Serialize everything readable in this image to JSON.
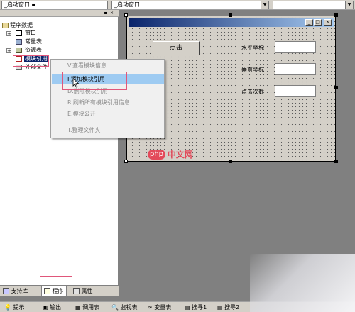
{
  "toolbar": {
    "combo1": "_启动窗口",
    "combo1_marker": "▪",
    "combo2": "_启动窗口",
    "combo3": "",
    "arrow": "▼"
  },
  "panel": {
    "pin": "▪",
    "close": "×"
  },
  "tree": {
    "root": "程序数据",
    "items": [
      {
        "label": "窗口",
        "expander": "+"
      },
      {
        "label": "常量表...",
        "expander": ""
      },
      {
        "label": "资源表",
        "expander": "+"
      },
      {
        "label": "模块引用",
        "expander": "",
        "selected": true
      },
      {
        "label": "外部文件",
        "expander": ""
      }
    ]
  },
  "context_menu": {
    "items": [
      {
        "label": "V.查看模块信息",
        "enabled": false,
        "active": false
      },
      {
        "label": "I.添加模块引用",
        "enabled": true,
        "active": true
      },
      {
        "label": "D.删除模块引用",
        "enabled": false,
        "active": false
      },
      {
        "label": "R.刷新所有模块引用信息",
        "enabled": false,
        "active": false
      },
      {
        "label": "E.模块公开",
        "enabled": false,
        "active": false
      },
      {
        "label": "T.整理文件夹",
        "enabled": false,
        "active": false
      }
    ]
  },
  "left_tabs": [
    {
      "label": "支持库",
      "icon": "library-icon"
    },
    {
      "label": "程序",
      "icon": "program-icon"
    },
    {
      "label": "属性",
      "icon": "property-icon"
    }
  ],
  "design_window": {
    "button_label": "点击",
    "fields": [
      {
        "label": "水平坐标"
      },
      {
        "label": "垂直坐标"
      },
      {
        "label": "点击次数"
      }
    ],
    "title_buttons": [
      "_",
      "□",
      "×"
    ]
  },
  "statusbar": {
    "items": [
      "提示",
      "输出",
      "调用表",
      "监视表",
      "变量表",
      "搜寻1",
      "搜寻2"
    ]
  },
  "watermark": {
    "logo": "php",
    "text": "中文网"
  },
  "colors": {
    "accent_red": "#e0567a",
    "menu_highlight": "#9ecbf2",
    "title_dark": "#0a246a"
  }
}
